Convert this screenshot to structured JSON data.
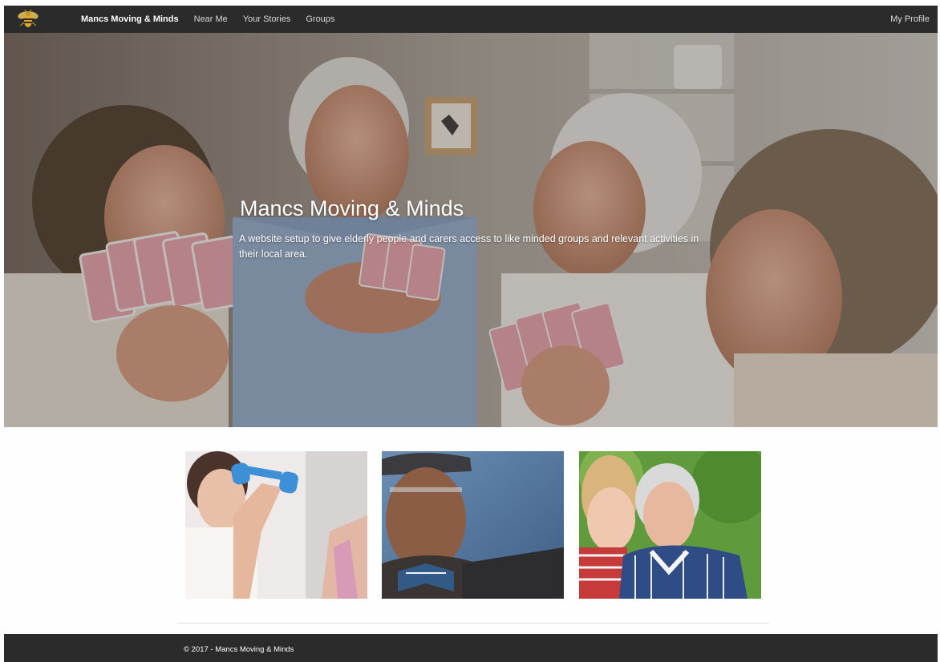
{
  "navbar": {
    "logo_icon": "bee-icon",
    "brand": "Mancs Moving & Minds",
    "links": [
      "Near Me",
      "Your Stories",
      "Groups"
    ],
    "profile": "My Profile"
  },
  "hero": {
    "title": "Mancs Moving & Minds",
    "description": "A website setup to give elderly people and carers access to like minded groups and relevant activities in their local area."
  },
  "thumbnails": [
    "exercise-photo",
    "gentleman-photo",
    "carer-photo"
  ],
  "footer": {
    "copyright": "© 2017 - Mancs Moving & Minds"
  },
  "colors": {
    "navbar_bg": "#2b2b2b",
    "footer_bg": "#2b2b2b",
    "brand_accent": "#d9a832"
  }
}
